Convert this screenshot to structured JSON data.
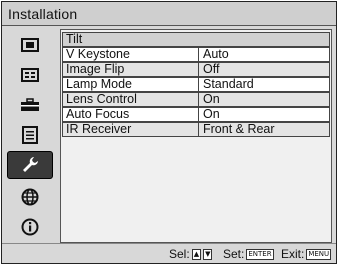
{
  "window": {
    "title": "Installation"
  },
  "sidebar": {
    "items": [
      {
        "icon": "picture-icon"
      },
      {
        "icon": "screen-icon"
      },
      {
        "icon": "toolbox-icon"
      },
      {
        "icon": "list-icon"
      },
      {
        "icon": "wrench-icon",
        "selected": true
      },
      {
        "icon": "globe-icon"
      },
      {
        "icon": "info-icon"
      }
    ]
  },
  "menu": {
    "header": "Tilt",
    "rows": [
      {
        "label": "V Keystone",
        "value": "Auto"
      },
      {
        "label": "Image Flip",
        "value": "Off"
      },
      {
        "label": "Lamp Mode",
        "value": "Standard"
      },
      {
        "label": "Lens Control",
        "value": "On"
      },
      {
        "label": "Auto Focus",
        "value": "On"
      },
      {
        "label": "IR Receiver",
        "value": "Front & Rear"
      }
    ]
  },
  "footer": {
    "sel_label": "Sel:",
    "set_label": "Set:",
    "set_key": "ENTER",
    "exit_label": "Exit:",
    "exit_key": "MENU"
  }
}
